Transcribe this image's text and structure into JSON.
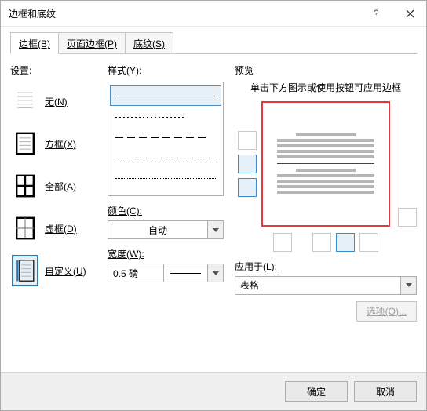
{
  "window": {
    "title": "边框和底纹"
  },
  "tabs": {
    "border": "边框(B)",
    "page_border": "页面边框(P)",
    "shading": "底纹(S)"
  },
  "settings": {
    "label": "设置:",
    "none": "无(N)",
    "box": "方框(X)",
    "all": "全部(A)",
    "grid": "虚框(D)",
    "custom": "自定义(U)"
  },
  "style": {
    "label": "样式(Y):",
    "color_label": "颜色(C):",
    "color_value": "自动",
    "width_label": "宽度(W):",
    "width_value": "0.5 磅"
  },
  "preview": {
    "label": "预览",
    "hint": "单击下方图示或使用按钮可应用边框",
    "apply_label": "应用于(L):",
    "apply_value": "表格"
  },
  "footer": {
    "options": "选项(O)...",
    "ok": "确定",
    "cancel": "取消"
  }
}
